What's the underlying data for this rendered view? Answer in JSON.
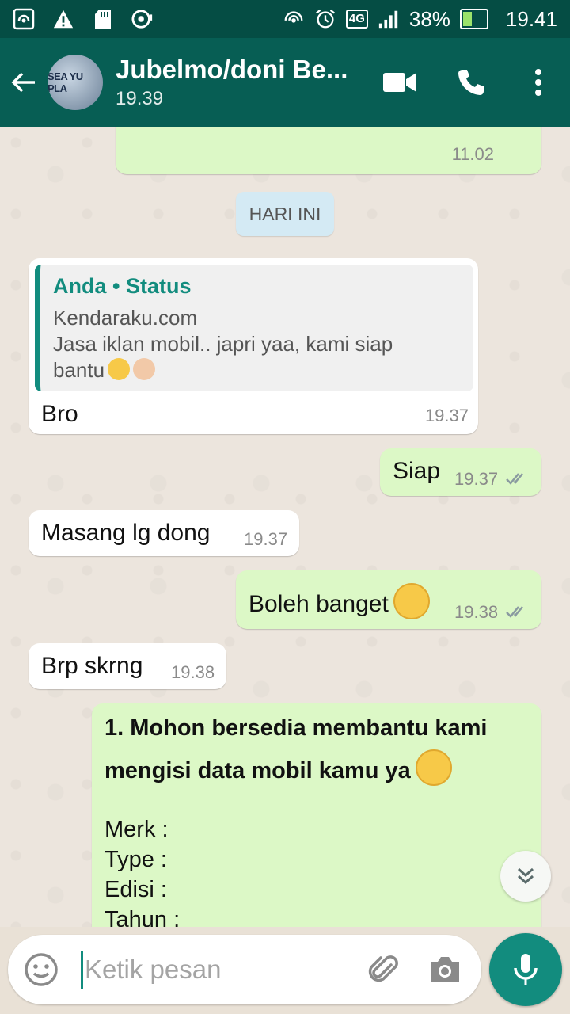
{
  "statusbar": {
    "battery": "38%",
    "network": "4G",
    "time": "19.41",
    "battery_level": 0.38
  },
  "header": {
    "contact_name": "Jubelmo/doni Be...",
    "last_seen": "19.39",
    "avatar_text": "SEA YU PLA"
  },
  "chat": {
    "prev_message_time": "11.02",
    "date_chip": "HARI INI",
    "messages": [
      {
        "direction": "in",
        "quote_author": "Anda • Status",
        "quote_line1": "Kendaraku.com",
        "quote_line2": "Jasa iklan mobil.. japri yaa, kami siap",
        "quote_line3": "bantu",
        "text": "Bro",
        "time": "19.37"
      },
      {
        "direction": "out",
        "text": "Siap",
        "time": "19.37"
      },
      {
        "direction": "in",
        "text": "Masang lg dong",
        "time": "19.37"
      },
      {
        "direction": "out",
        "text": "Boleh banget",
        "time": "19.38"
      },
      {
        "direction": "in",
        "text": "Brp skrng",
        "time": "19.38"
      },
      {
        "direction": "out",
        "bold_line1": "1. Mohon bersedia membantu kami",
        "bold_line2": "mengisi data mobil kamu ya",
        "lines": [
          "Merk :",
          "Type :",
          "Edisi :",
          "Tahun :"
        ]
      }
    ]
  },
  "composer": {
    "placeholder": "Ketik pesan"
  },
  "colors": {
    "header": "#075e54",
    "statusbar": "#054d44",
    "outgoing": "#dcf8c6",
    "incoming": "#ffffff",
    "accent": "#128c7e",
    "read_ticks": "#8a9aa0"
  },
  "icons": [
    "wifi-hotspot-icon",
    "warning-icon",
    "sd-card-icon",
    "cast-icon",
    "alarm-icon",
    "signal-icon",
    "battery-charging-icon",
    "back-arrow-icon",
    "video-call-icon",
    "phone-icon",
    "more-vert-icon",
    "double-tick-icon",
    "scroll-down-icon",
    "emoji-icon",
    "attach-icon",
    "camera-icon",
    "mic-icon"
  ]
}
